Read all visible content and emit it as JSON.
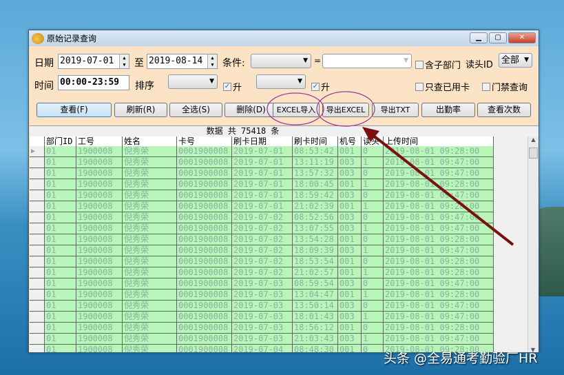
{
  "window": {
    "title": "原始记录查询"
  },
  "form": {
    "date_label": "日期",
    "date_from": "2019-07-01",
    "to_label": "至",
    "date_to": "2019-08-14",
    "condition_label": "条件:",
    "condition_value": "",
    "equals": "=",
    "condition_input": "",
    "include_sub_dept": "含子部门",
    "reader_id_label": "读头ID",
    "reader_id_value": "全部",
    "time_label": "时间",
    "time_value": "00:00-23:59",
    "sort_label": "排序",
    "sort1": "",
    "asc1": "升",
    "asc1_checked": true,
    "sort2": "",
    "asc2": "升",
    "asc2_checked": true,
    "only_used_cards": "只查已用卡",
    "access_query": "门禁查询"
  },
  "buttons": [
    "查看(F)",
    "刷新(R)",
    "全选(S)",
    "删除(D)",
    "EXCEL导入",
    "导出EXCEL",
    "导出TXT",
    "出勤率",
    "查看次数"
  ],
  "grid": {
    "caption": "数据 共 75418 条",
    "columns": [
      "部门ID",
      "工号",
      "姓名",
      "卡号",
      "刷卡日期",
      "刷卡时间",
      "机号",
      "读头",
      "上传时间"
    ],
    "rows": [
      [
        "01",
        "1900008",
        "倪秀荣",
        "0001900008",
        "2019-07-01",
        "08:53:42",
        "001",
        "0",
        "2019-08-01 09:28:00"
      ],
      [
        "01",
        "1900008",
        "倪秀荣",
        "0001900008",
        "2019-07-01",
        "13:11:19",
        "003",
        "1",
        "2019-08-01 09:47:00"
      ],
      [
        "01",
        "1900008",
        "倪秀荣",
        "0001900008",
        "2019-07-01",
        "13:57:32",
        "003",
        "0",
        "2019-08-01 09:47:00"
      ],
      [
        "01",
        "1900008",
        "倪秀荣",
        "0001900008",
        "2019-07-01",
        "18:00:45",
        "001",
        "1",
        "2019-08-01 09:28:00"
      ],
      [
        "01",
        "1900008",
        "倪秀荣",
        "0001900008",
        "2019-07-01",
        "18:59:42",
        "003",
        "0",
        "2019-08-01 09:47:00"
      ],
      [
        "01",
        "1900008",
        "倪秀荣",
        "0001900008",
        "2019-07-01",
        "21:02:39",
        "001",
        "1",
        "2019-08-01 09:28:00"
      ],
      [
        "01",
        "1900008",
        "倪秀荣",
        "0001900008",
        "2019-07-02",
        "08:52:56",
        "003",
        "0",
        "2019-08-01 09:47:00"
      ],
      [
        "01",
        "1900008",
        "倪秀荣",
        "0001900008",
        "2019-07-02",
        "13:07:55",
        "003",
        "1",
        "2019-08-01 09:47:00"
      ],
      [
        "01",
        "1900008",
        "倪秀荣",
        "0001900008",
        "2019-07-02",
        "13:54:28",
        "001",
        "0",
        "2019-08-01 09:28:00"
      ],
      [
        "01",
        "1900008",
        "倪秀荣",
        "0001900008",
        "2019-07-02",
        "18:09:39",
        "003",
        "1",
        "2019-08-01 09:47:00"
      ],
      [
        "01",
        "1900008",
        "倪秀荣",
        "0001900008",
        "2019-07-02",
        "18:53:54",
        "001",
        "0",
        "2019-08-01 09:28:00"
      ],
      [
        "01",
        "1900008",
        "倪秀荣",
        "0001900008",
        "2019-07-02",
        "21:02:57",
        "001",
        "1",
        "2019-08-01 09:28:00"
      ],
      [
        "01",
        "1900008",
        "倪秀荣",
        "0001900008",
        "2019-07-03",
        "08:59:54",
        "003",
        "0",
        "2019-08-01 09:47:00"
      ],
      [
        "01",
        "1900008",
        "倪秀荣",
        "0001900008",
        "2019-07-03",
        "13:04:47",
        "001",
        "1",
        "2019-08-01 09:28:00"
      ],
      [
        "01",
        "1900008",
        "倪秀荣",
        "0001900008",
        "2019-07-03",
        "13:50:14",
        "003",
        "0",
        "2019-08-01 09:47:00"
      ],
      [
        "01",
        "1900008",
        "倪秀荣",
        "0001900008",
        "2019-07-03",
        "18:01:43",
        "003",
        "1",
        "2019-08-01 09:47:00"
      ],
      [
        "01",
        "1900008",
        "倪秀荣",
        "0001900008",
        "2019-07-03",
        "18:56:12",
        "001",
        "0",
        "2019-08-01 09:28:00"
      ],
      [
        "01",
        "1900008",
        "倪秀荣",
        "0001900008",
        "2019-07-03",
        "21:03:43",
        "003",
        "1",
        "2019-08-01 09:47:00"
      ],
      [
        "01",
        "1900008",
        "倪秀荣",
        "0001900008",
        "2019-07-04",
        "08:48:30",
        "001",
        "0",
        "2019-08-01 09:28:00"
      ]
    ]
  },
  "annotation": {
    "arrow_color": "#7a1010",
    "circle_color": "#9a3a9a"
  },
  "watermark": "头条 @全易通考勤验厂HR"
}
